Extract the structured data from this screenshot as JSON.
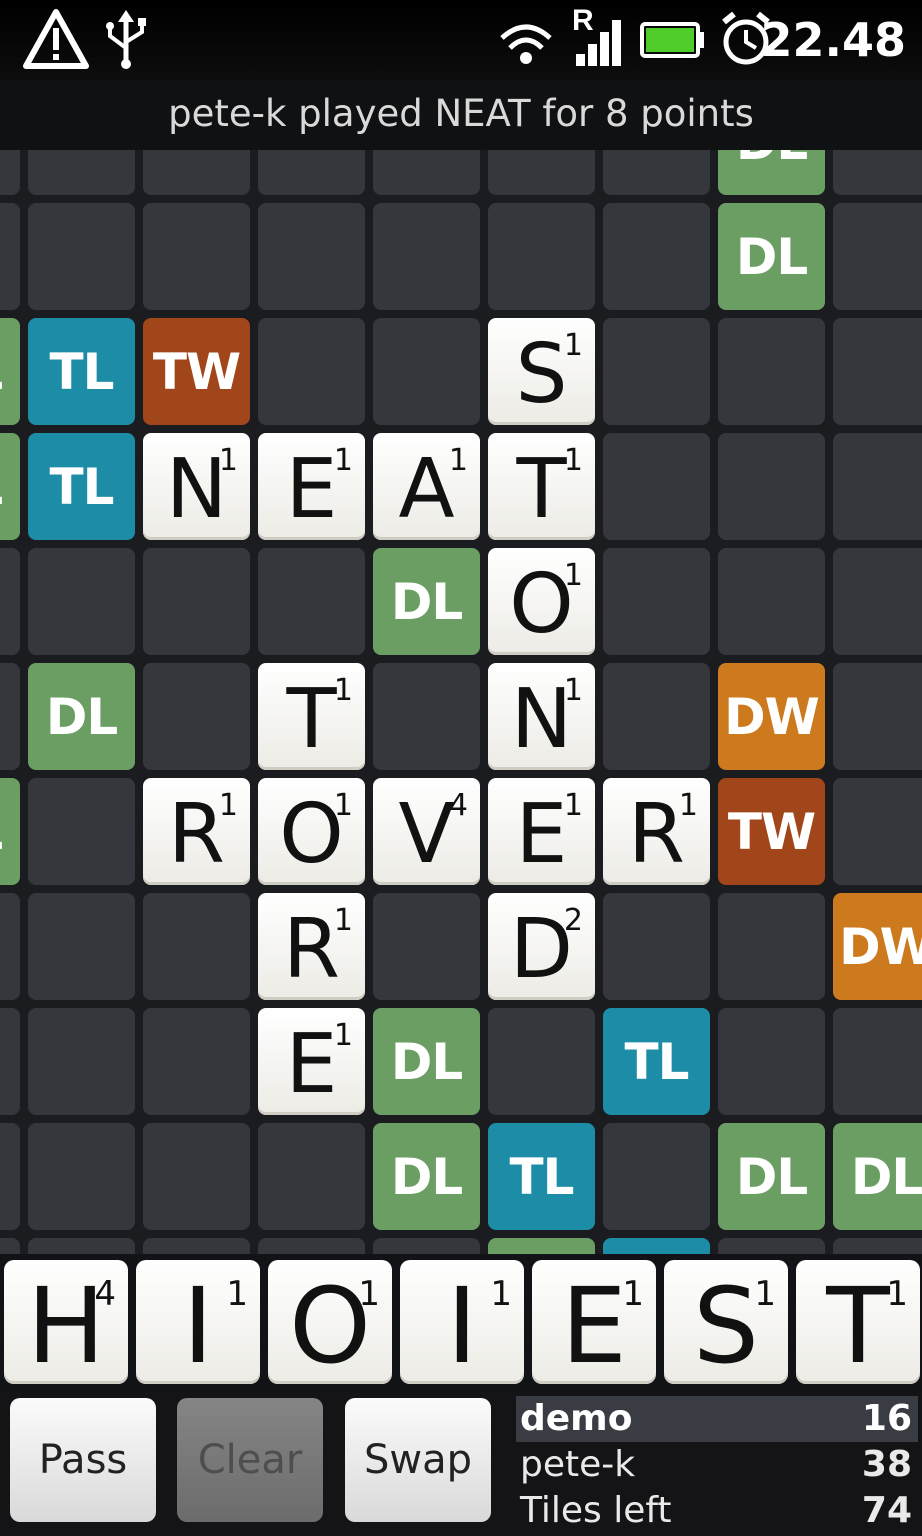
{
  "status_bar": {
    "icons": [
      "warning-icon",
      "usb-icon",
      "wifi-icon",
      "signal-icon",
      "battery-icon",
      "alarm-icon"
    ],
    "roaming_label": "R",
    "time": "22.48"
  },
  "last_move": "pete-k played NEAT for 8 points",
  "colors": {
    "DL": "#6a9e63",
    "TL": "#1d8ca6",
    "TW": "#a1451b",
    "DW": "#cc7a1d",
    "empty": "#35373d",
    "tile": "#f4f3ef"
  },
  "board": {
    "rows": [
      [
        ".",
        ".",
        ".",
        ".",
        ".",
        ".",
        "DL",
        "."
      ],
      [
        ".",
        ".",
        ".",
        ".",
        ".",
        ".",
        "DL",
        "."
      ],
      [
        "TL",
        "TW",
        ".",
        ".",
        "S1",
        ".",
        ".",
        "."
      ],
      [
        "TL",
        "N1",
        "E1",
        "A1",
        "T1",
        ".",
        ".",
        "."
      ],
      [
        ".",
        ".",
        ".",
        "DL",
        "O1",
        ".",
        ".",
        "."
      ],
      [
        "DL",
        ".",
        "T1",
        ".",
        "N1",
        ".",
        "DW",
        "."
      ],
      [
        ".",
        "R1",
        "O1",
        "V4",
        "E1",
        "R1",
        "TW",
        "."
      ],
      [
        ".",
        ".",
        "R1",
        ".",
        "D2",
        ".",
        ".",
        "DW"
      ],
      [
        ".",
        ".",
        "E1",
        "DL",
        ".",
        "TL",
        ".",
        "."
      ],
      [
        ".",
        ".",
        ".",
        "DL",
        "TL",
        ".",
        "DL",
        "DL"
      ],
      [
        ".",
        ".",
        ".",
        ".",
        "DL",
        "TL",
        ".",
        "."
      ]
    ],
    "left_edge": [
      "",
      "",
      "DL",
      "DL",
      "",
      "",
      "DL",
      "",
      "",
      "",
      ""
    ]
  },
  "rack": [
    {
      "letter": "H",
      "score": "4"
    },
    {
      "letter": "I",
      "score": "1"
    },
    {
      "letter": "O",
      "score": "1"
    },
    {
      "letter": "I",
      "score": "1"
    },
    {
      "letter": "E",
      "score": "1"
    },
    {
      "letter": "S",
      "score": "1"
    },
    {
      "letter": "T",
      "score": "1"
    }
  ],
  "buttons": {
    "pass": "Pass",
    "clear": "Clear",
    "swap": "Swap"
  },
  "scores": {
    "player1_name": "demo",
    "player1_score": "16",
    "player2_name": "pete-k",
    "player2_score": "38",
    "tiles_left_label": "Tiles left",
    "tiles_left": "74"
  }
}
